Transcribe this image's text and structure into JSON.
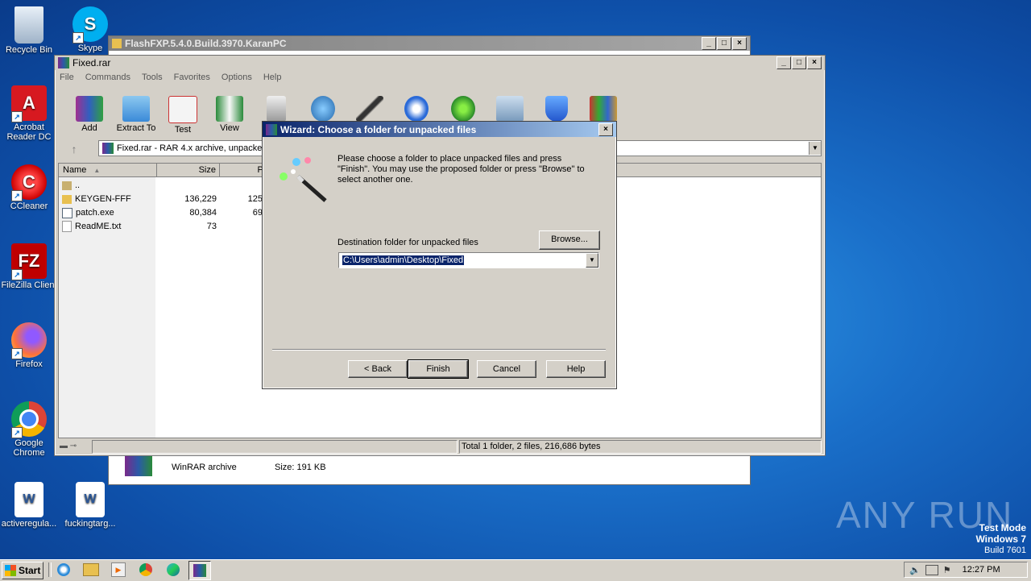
{
  "desktop": {
    "icons": [
      {
        "label": "Recycle Bin"
      },
      {
        "label": "Skype"
      },
      {
        "label": "Acrobat Reader DC"
      },
      {
        "label": "CCleaner"
      },
      {
        "label": "FileZilla Client"
      },
      {
        "label": "Firefox"
      },
      {
        "label": "Google Chrome"
      },
      {
        "label": "activeregula..."
      },
      {
        "label": "fuckingtarg..."
      }
    ],
    "watermark": {
      "text": "ANY RUN"
    },
    "test_mode": {
      "line1": "Test Mode",
      "line2": "Windows 7",
      "line3": "Build 7601"
    }
  },
  "flashfxp": {
    "title": "FlashFXP.5.4.0.Build.3970.KaranPC",
    "file_type": "WinRAR archive",
    "file_size": "Size: 191 KB"
  },
  "winrar": {
    "title": "Fixed.rar",
    "menu": [
      "File",
      "Commands",
      "Tools",
      "Favorites",
      "Options",
      "Help"
    ],
    "toolbar": [
      "Add",
      "Extract To",
      "Test",
      "View",
      "D"
    ],
    "path": "Fixed.rar - RAR 4.x archive, unpacke",
    "columns": {
      "name": "Name",
      "size": "Size",
      "packed": "Pa"
    },
    "rows": [
      {
        "name": "..",
        "size": "",
        "packed": ""
      },
      {
        "name": "KEYGEN-FFF",
        "size": "136,229",
        "packed": "125,"
      },
      {
        "name": "patch.exe",
        "size": "80,384",
        "packed": "69,"
      },
      {
        "name": "ReadME.txt",
        "size": "73",
        "packed": ""
      }
    ],
    "status": "Total 1 folder, 2 files, 216,686 bytes"
  },
  "wizard": {
    "title": "Wizard:  Choose a folder for unpacked files",
    "instructions": "Please choose a folder to place unpacked files and press \"Finish\". You may use the proposed folder or press \"Browse\" to select another one.",
    "dest_label": "Destination folder for unpacked files",
    "dest_value": "C:\\Users\\admin\\Desktop\\Fixed",
    "browse": "Browse...",
    "back": "< Back",
    "finish": "Finish",
    "cancel": "Cancel",
    "help": "Help"
  },
  "taskbar": {
    "start": "Start",
    "clock": "12:27 PM"
  }
}
